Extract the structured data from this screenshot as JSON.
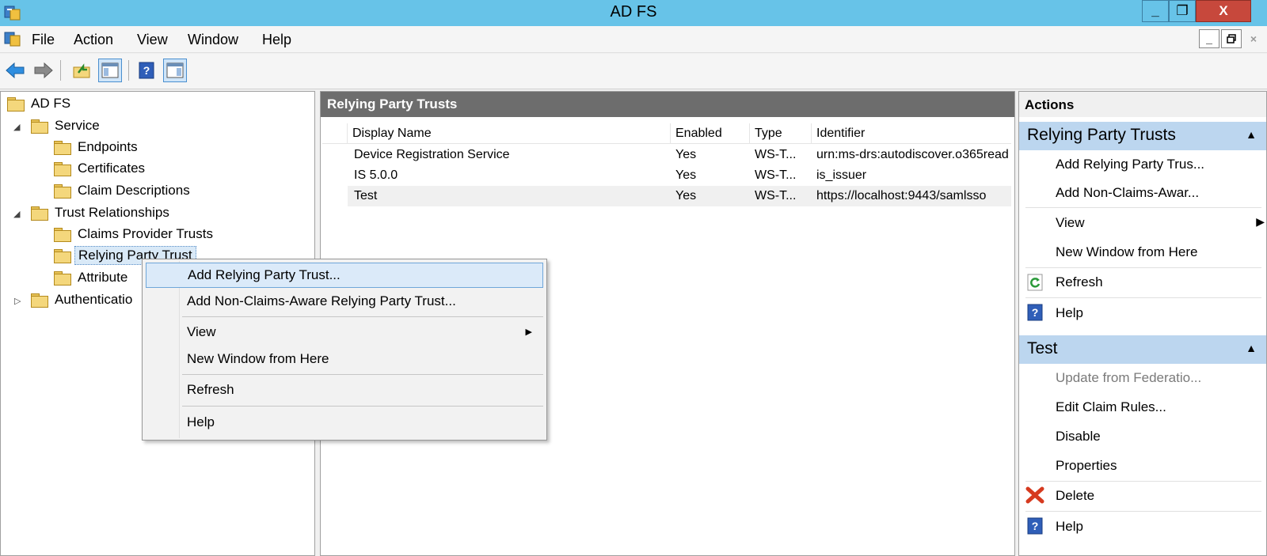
{
  "window": {
    "title": "AD FS",
    "minimize": "_",
    "maximize": "❐",
    "close": "X"
  },
  "menubar": {
    "items": [
      "File",
      "Action",
      "View",
      "Window",
      "Help"
    ],
    "mdi_min": "_",
    "mdi_restore": "🗗",
    "mdi_close": "×"
  },
  "toolbar": {
    "buttons": [
      "back-icon",
      "forward-icon",
      "up-folder-icon",
      "show-hide-tree-icon",
      "help-icon",
      "show-hide-action-pane-icon"
    ]
  },
  "tree": {
    "root": "AD FS",
    "service": "Service",
    "endpoints": "Endpoints",
    "certificates": "Certificates",
    "claim_descriptions": "Claim Descriptions",
    "trust_relationships": "Trust Relationships",
    "claims_provider_trusts": "Claims Provider Trusts",
    "relying_party_trusts": "Relying Party Trust",
    "attribute_stores": "Attribute",
    "authentication_policies": "Authenticatio"
  },
  "center": {
    "header": "Relying Party Trusts",
    "columns": [
      "Display Name",
      "Enabled",
      "Type",
      "Identifier"
    ],
    "rows": [
      {
        "name": "Device Registration Service",
        "enabled": "Yes",
        "type": "WS-T...",
        "identifier": "urn:ms-drs:autodiscover.o365read"
      },
      {
        "name": "IS 5.0.0",
        "enabled": "Yes",
        "type": "WS-T...",
        "identifier": "is_issuer"
      },
      {
        "name": "Test",
        "enabled": "Yes",
        "type": "WS-T...",
        "identifier": "https://localhost:9443/samlsso"
      }
    ]
  },
  "actions": {
    "title": "Actions",
    "section1": {
      "title": "Relying Party Trusts",
      "items": [
        "Add Relying Party Trus...",
        "Add Non-Claims-Awar...",
        "View",
        "New Window from Here",
        "Refresh",
        "Help"
      ]
    },
    "section2": {
      "title": "Test",
      "items": [
        "Update from Federatio...",
        "Edit Claim Rules...",
        "Disable",
        "Properties",
        "Delete",
        "Help"
      ]
    }
  },
  "context_menu": {
    "items": [
      "Add Relying Party Trust...",
      "Add Non-Claims-Aware Relying Party Trust...",
      "View",
      "New Window from Here",
      "Refresh",
      "Help"
    ]
  },
  "colors": {
    "titlebar": "#67c3e8",
    "close_button": "#c7483c",
    "section_header": "#bcd6ef",
    "center_header": "#6d6d6d",
    "menu_hover": "#dbeaf9"
  }
}
